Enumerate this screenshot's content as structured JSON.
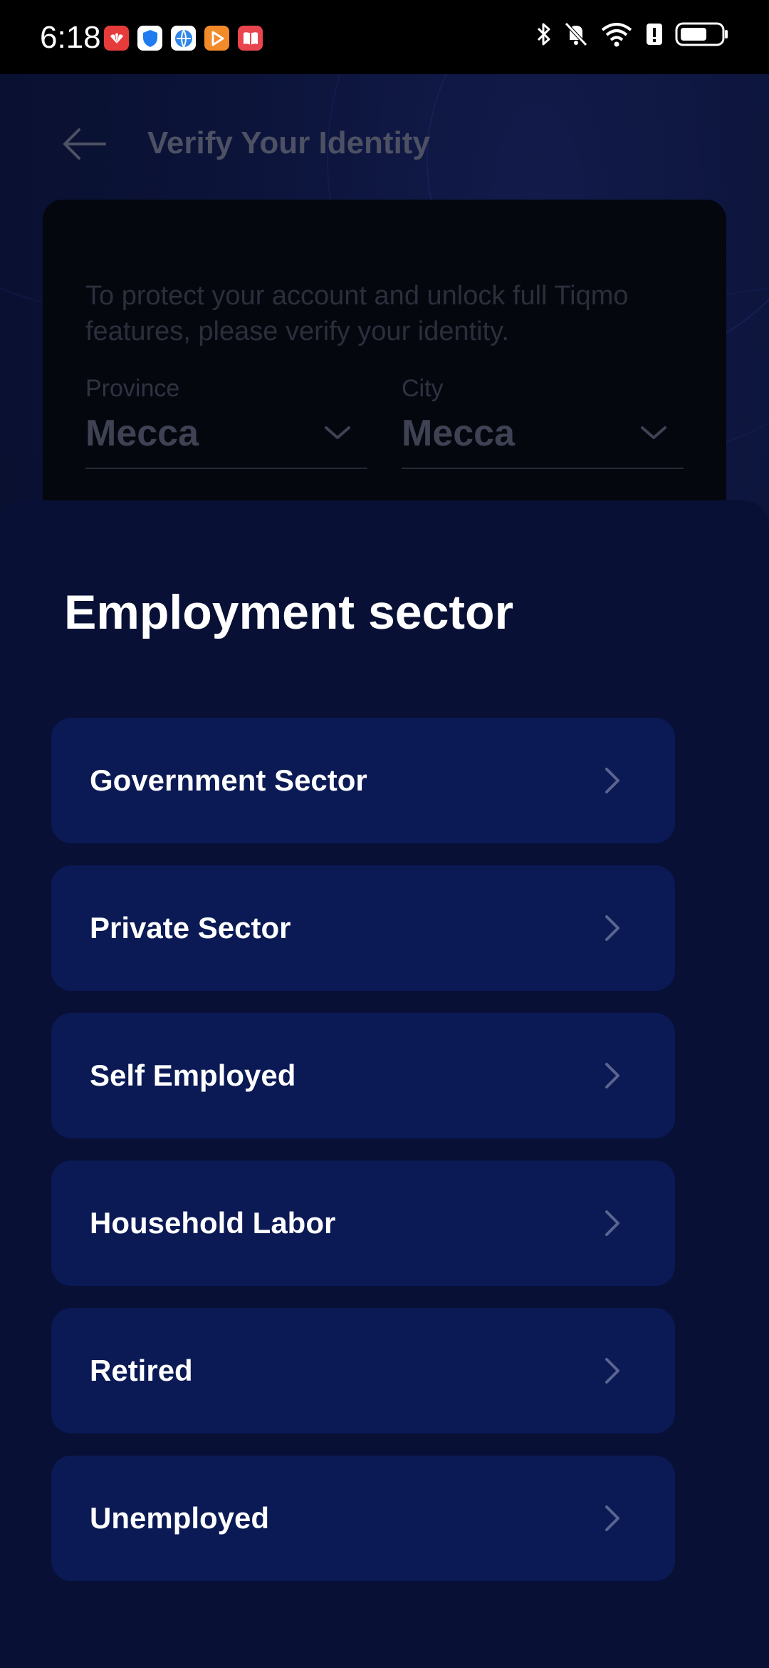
{
  "status_bar": {
    "time": "6:18",
    "app_icons": [
      "huawei-app-icon",
      "shield-app-icon",
      "browser-app-icon",
      "video-app-icon",
      "book-app-icon"
    ],
    "system_icons": [
      "bluetooth-icon",
      "notifications-muted-icon",
      "wifi-icon",
      "battery-alert-icon",
      "battery-icon"
    ]
  },
  "header": {
    "title": "Verify Your Identity",
    "back_icon": "back-arrow-icon"
  },
  "info_card": {
    "description": "To protect your account and unlock full Tiqmo features, please verify your identity.",
    "province": {
      "label": "Province",
      "value": "Mecca"
    },
    "city": {
      "label": "City",
      "value": "Mecca"
    }
  },
  "sheet": {
    "title": "Employment sector",
    "options": [
      {
        "label": "Government Sector"
      },
      {
        "label": "Private Sector"
      },
      {
        "label": "Self Employed"
      },
      {
        "label": "Household Labor"
      },
      {
        "label": "Retired"
      },
      {
        "label": "Unemployed"
      }
    ]
  },
  "colors": {
    "sheet_background": "#081036",
    "option_background": "#0b1a55",
    "title_text": "#ffffff",
    "chevron": "#5a6590"
  }
}
